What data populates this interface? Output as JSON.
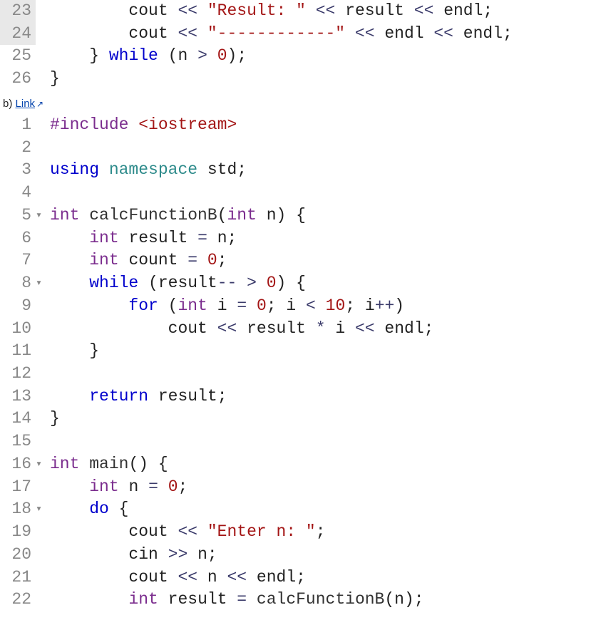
{
  "block1": {
    "lines": [
      {
        "n": "23",
        "hi": true,
        "fold": "",
        "tokens": [
          {
            "t": "        ",
            "c": ""
          },
          {
            "t": "cout",
            "c": ""
          },
          {
            "t": " ",
            "c": ""
          },
          {
            "t": "<<",
            "c": "op"
          },
          {
            "t": " ",
            "c": ""
          },
          {
            "t": "\"Result: \"",
            "c": "str"
          },
          {
            "t": " ",
            "c": ""
          },
          {
            "t": "<<",
            "c": "op"
          },
          {
            "t": " ",
            "c": ""
          },
          {
            "t": "result",
            "c": ""
          },
          {
            "t": " ",
            "c": ""
          },
          {
            "t": "<<",
            "c": "op"
          },
          {
            "t": " ",
            "c": ""
          },
          {
            "t": "endl",
            "c": ""
          },
          {
            "t": ";",
            "c": "punc"
          }
        ]
      },
      {
        "n": "24",
        "hi": true,
        "fold": "",
        "tokens": [
          {
            "t": "        ",
            "c": ""
          },
          {
            "t": "cout",
            "c": ""
          },
          {
            "t": " ",
            "c": ""
          },
          {
            "t": "<<",
            "c": "op"
          },
          {
            "t": " ",
            "c": ""
          },
          {
            "t": "\"------------\"",
            "c": "str"
          },
          {
            "t": " ",
            "c": ""
          },
          {
            "t": "<<",
            "c": "op"
          },
          {
            "t": " ",
            "c": ""
          },
          {
            "t": "endl",
            "c": ""
          },
          {
            "t": " ",
            "c": ""
          },
          {
            "t": "<<",
            "c": "op"
          },
          {
            "t": " ",
            "c": ""
          },
          {
            "t": "endl",
            "c": ""
          },
          {
            "t": ";",
            "c": "punc"
          }
        ]
      },
      {
        "n": "25",
        "hi": false,
        "fold": "",
        "tokens": [
          {
            "t": "    ",
            "c": ""
          },
          {
            "t": "}",
            "c": "punc"
          },
          {
            "t": " ",
            "c": ""
          },
          {
            "t": "while",
            "c": "kw"
          },
          {
            "t": " ",
            "c": ""
          },
          {
            "t": "(",
            "c": "punc"
          },
          {
            "t": "n",
            "c": ""
          },
          {
            "t": " ",
            "c": ""
          },
          {
            "t": ">",
            "c": "op"
          },
          {
            "t": " ",
            "c": ""
          },
          {
            "t": "0",
            "c": "num"
          },
          {
            "t": ")",
            "c": "punc"
          },
          {
            "t": ";",
            "c": "punc"
          }
        ]
      },
      {
        "n": "26",
        "hi": false,
        "fold": "",
        "tokens": [
          {
            "t": "}",
            "c": "punc"
          }
        ]
      }
    ]
  },
  "label": {
    "prefix": "b) ",
    "link_text": "Link",
    "ext_icon": "↗"
  },
  "block2": {
    "lines": [
      {
        "n": "1",
        "fold": "",
        "tokens": [
          {
            "t": "#include",
            "c": "pp"
          },
          {
            "t": " ",
            "c": ""
          },
          {
            "t": "<iostream>",
            "c": "str"
          }
        ]
      },
      {
        "n": "2",
        "fold": "",
        "tokens": [
          {
            "t": "",
            "c": ""
          }
        ]
      },
      {
        "n": "3",
        "fold": "",
        "tokens": [
          {
            "t": "using",
            "c": "kw"
          },
          {
            "t": " ",
            "c": ""
          },
          {
            "t": "namespace",
            "c": "ns"
          },
          {
            "t": " ",
            "c": ""
          },
          {
            "t": "std",
            "c": ""
          },
          {
            "t": ";",
            "c": "punc"
          }
        ]
      },
      {
        "n": "4",
        "fold": "",
        "tokens": [
          {
            "t": "",
            "c": ""
          }
        ]
      },
      {
        "n": "5",
        "fold": "▾",
        "tokens": [
          {
            "t": "int",
            "c": "ty"
          },
          {
            "t": " ",
            "c": ""
          },
          {
            "t": "calcFunctionB",
            "c": "fn"
          },
          {
            "t": "(",
            "c": "punc"
          },
          {
            "t": "int",
            "c": "ty"
          },
          {
            "t": " ",
            "c": ""
          },
          {
            "t": "n",
            "c": ""
          },
          {
            "t": ")",
            "c": "punc"
          },
          {
            "t": " ",
            "c": ""
          },
          {
            "t": "{",
            "c": "punc"
          }
        ]
      },
      {
        "n": "6",
        "fold": "",
        "tokens": [
          {
            "t": "    ",
            "c": ""
          },
          {
            "t": "int",
            "c": "ty"
          },
          {
            "t": " ",
            "c": ""
          },
          {
            "t": "result",
            "c": ""
          },
          {
            "t": " ",
            "c": ""
          },
          {
            "t": "=",
            "c": "op"
          },
          {
            "t": " ",
            "c": ""
          },
          {
            "t": "n",
            "c": ""
          },
          {
            "t": ";",
            "c": "punc"
          }
        ]
      },
      {
        "n": "7",
        "fold": "",
        "tokens": [
          {
            "t": "    ",
            "c": ""
          },
          {
            "t": "int",
            "c": "ty"
          },
          {
            "t": " ",
            "c": ""
          },
          {
            "t": "count",
            "c": ""
          },
          {
            "t": " ",
            "c": ""
          },
          {
            "t": "=",
            "c": "op"
          },
          {
            "t": " ",
            "c": ""
          },
          {
            "t": "0",
            "c": "num"
          },
          {
            "t": ";",
            "c": "punc"
          }
        ]
      },
      {
        "n": "8",
        "fold": "▾",
        "tokens": [
          {
            "t": "    ",
            "c": ""
          },
          {
            "t": "while",
            "c": "kw"
          },
          {
            "t": " ",
            "c": ""
          },
          {
            "t": "(",
            "c": "punc"
          },
          {
            "t": "result",
            "c": ""
          },
          {
            "t": "--",
            "c": "op"
          },
          {
            "t": " ",
            "c": ""
          },
          {
            "t": ">",
            "c": "op"
          },
          {
            "t": " ",
            "c": ""
          },
          {
            "t": "0",
            "c": "num"
          },
          {
            "t": ")",
            "c": "punc"
          },
          {
            "t": " ",
            "c": ""
          },
          {
            "t": "{",
            "c": "punc"
          }
        ]
      },
      {
        "n": "9",
        "fold": "",
        "tokens": [
          {
            "t": "        ",
            "c": ""
          },
          {
            "t": "for",
            "c": "kw"
          },
          {
            "t": " ",
            "c": ""
          },
          {
            "t": "(",
            "c": "punc"
          },
          {
            "t": "int",
            "c": "ty"
          },
          {
            "t": " ",
            "c": ""
          },
          {
            "t": "i",
            "c": ""
          },
          {
            "t": " ",
            "c": ""
          },
          {
            "t": "=",
            "c": "op"
          },
          {
            "t": " ",
            "c": ""
          },
          {
            "t": "0",
            "c": "num"
          },
          {
            "t": ";",
            "c": "punc"
          },
          {
            "t": " ",
            "c": ""
          },
          {
            "t": "i",
            "c": ""
          },
          {
            "t": " ",
            "c": ""
          },
          {
            "t": "<",
            "c": "op"
          },
          {
            "t": " ",
            "c": ""
          },
          {
            "t": "10",
            "c": "num"
          },
          {
            "t": ";",
            "c": "punc"
          },
          {
            "t": " ",
            "c": ""
          },
          {
            "t": "i",
            "c": ""
          },
          {
            "t": "++",
            "c": "op"
          },
          {
            "t": ")",
            "c": "punc"
          }
        ]
      },
      {
        "n": "10",
        "fold": "",
        "tokens": [
          {
            "t": "            ",
            "c": ""
          },
          {
            "t": "cout",
            "c": ""
          },
          {
            "t": " ",
            "c": ""
          },
          {
            "t": "<<",
            "c": "op"
          },
          {
            "t": " ",
            "c": ""
          },
          {
            "t": "result",
            "c": ""
          },
          {
            "t": " ",
            "c": ""
          },
          {
            "t": "*",
            "c": "op"
          },
          {
            "t": " ",
            "c": ""
          },
          {
            "t": "i",
            "c": ""
          },
          {
            "t": " ",
            "c": ""
          },
          {
            "t": "<<",
            "c": "op"
          },
          {
            "t": " ",
            "c": ""
          },
          {
            "t": "endl",
            "c": ""
          },
          {
            "t": ";",
            "c": "punc"
          }
        ]
      },
      {
        "n": "11",
        "fold": "",
        "tokens": [
          {
            "t": "    ",
            "c": ""
          },
          {
            "t": "}",
            "c": "punc"
          }
        ]
      },
      {
        "n": "12",
        "fold": "",
        "tokens": [
          {
            "t": "",
            "c": ""
          }
        ]
      },
      {
        "n": "13",
        "fold": "",
        "tokens": [
          {
            "t": "    ",
            "c": ""
          },
          {
            "t": "return",
            "c": "kw"
          },
          {
            "t": " ",
            "c": ""
          },
          {
            "t": "result",
            "c": ""
          },
          {
            "t": ";",
            "c": "punc"
          }
        ]
      },
      {
        "n": "14",
        "fold": "",
        "tokens": [
          {
            "t": "}",
            "c": "punc"
          }
        ]
      },
      {
        "n": "15",
        "fold": "",
        "tokens": [
          {
            "t": "",
            "c": ""
          }
        ]
      },
      {
        "n": "16",
        "fold": "▾",
        "tokens": [
          {
            "t": "int",
            "c": "ty"
          },
          {
            "t": " ",
            "c": ""
          },
          {
            "t": "main",
            "c": "fn"
          },
          {
            "t": "()",
            "c": "punc"
          },
          {
            "t": " ",
            "c": ""
          },
          {
            "t": "{",
            "c": "punc"
          }
        ]
      },
      {
        "n": "17",
        "fold": "",
        "tokens": [
          {
            "t": "    ",
            "c": ""
          },
          {
            "t": "int",
            "c": "ty"
          },
          {
            "t": " ",
            "c": ""
          },
          {
            "t": "n",
            "c": ""
          },
          {
            "t": " ",
            "c": ""
          },
          {
            "t": "=",
            "c": "op"
          },
          {
            "t": " ",
            "c": ""
          },
          {
            "t": "0",
            "c": "num"
          },
          {
            "t": ";",
            "c": "punc"
          }
        ]
      },
      {
        "n": "18",
        "fold": "▾",
        "tokens": [
          {
            "t": "    ",
            "c": ""
          },
          {
            "t": "do",
            "c": "kw"
          },
          {
            "t": " ",
            "c": ""
          },
          {
            "t": "{",
            "c": "punc"
          }
        ]
      },
      {
        "n": "19",
        "fold": "",
        "tokens": [
          {
            "t": "        ",
            "c": ""
          },
          {
            "t": "cout",
            "c": ""
          },
          {
            "t": " ",
            "c": ""
          },
          {
            "t": "<<",
            "c": "op"
          },
          {
            "t": " ",
            "c": ""
          },
          {
            "t": "\"Enter n: \"",
            "c": "str"
          },
          {
            "t": ";",
            "c": "punc"
          }
        ]
      },
      {
        "n": "20",
        "fold": "",
        "tokens": [
          {
            "t": "        ",
            "c": ""
          },
          {
            "t": "cin",
            "c": ""
          },
          {
            "t": " ",
            "c": ""
          },
          {
            "t": ">>",
            "c": "op"
          },
          {
            "t": " ",
            "c": ""
          },
          {
            "t": "n",
            "c": ""
          },
          {
            "t": ";",
            "c": "punc"
          }
        ]
      },
      {
        "n": "21",
        "fold": "",
        "tokens": [
          {
            "t": "        ",
            "c": ""
          },
          {
            "t": "cout",
            "c": ""
          },
          {
            "t": " ",
            "c": ""
          },
          {
            "t": "<<",
            "c": "op"
          },
          {
            "t": " ",
            "c": ""
          },
          {
            "t": "n",
            "c": ""
          },
          {
            "t": " ",
            "c": ""
          },
          {
            "t": "<<",
            "c": "op"
          },
          {
            "t": " ",
            "c": ""
          },
          {
            "t": "endl",
            "c": ""
          },
          {
            "t": ";",
            "c": "punc"
          }
        ]
      },
      {
        "n": "22",
        "fold": "",
        "tokens": [
          {
            "t": "        ",
            "c": ""
          },
          {
            "t": "int",
            "c": "ty"
          },
          {
            "t": " ",
            "c": ""
          },
          {
            "t": "result",
            "c": ""
          },
          {
            "t": " ",
            "c": ""
          },
          {
            "t": "=",
            "c": "op"
          },
          {
            "t": " ",
            "c": ""
          },
          {
            "t": "calcFunctionB",
            "c": "fn"
          },
          {
            "t": "(",
            "c": "punc"
          },
          {
            "t": "n",
            "c": ""
          },
          {
            "t": ")",
            "c": "punc"
          },
          {
            "t": ";",
            "c": "punc"
          }
        ]
      }
    ]
  }
}
